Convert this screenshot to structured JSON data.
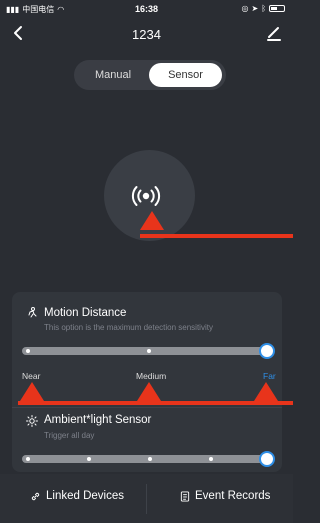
{
  "status": {
    "carrier": "中国电信",
    "time": "16:38"
  },
  "header": {
    "title": "1234"
  },
  "mode": {
    "manual_label": "Manual",
    "sensor_label": "Sensor",
    "selected": "Sensor"
  },
  "motion": {
    "title": "Motion Distance",
    "subtitle": "This option is the maximum detection sensitivity",
    "labels": [
      "Near",
      "Medium",
      "Far"
    ],
    "selected_index": 2
  },
  "ambient": {
    "title": "Ambient*light Sensor",
    "subtitle": "Trigger all day",
    "selected_fraction": 1.0
  },
  "bottom": {
    "linked_label": "Linked Devices",
    "records_label": "Event Records"
  },
  "colors": {
    "accent": "#2e8ee6",
    "annotation_red": "#e8341b",
    "background": "#2a2d33"
  },
  "icons": [
    "back-icon",
    "edit-icon",
    "sensor-signal-icon",
    "motion-icon",
    "sun-icon",
    "link-icon",
    "records-icon"
  ]
}
